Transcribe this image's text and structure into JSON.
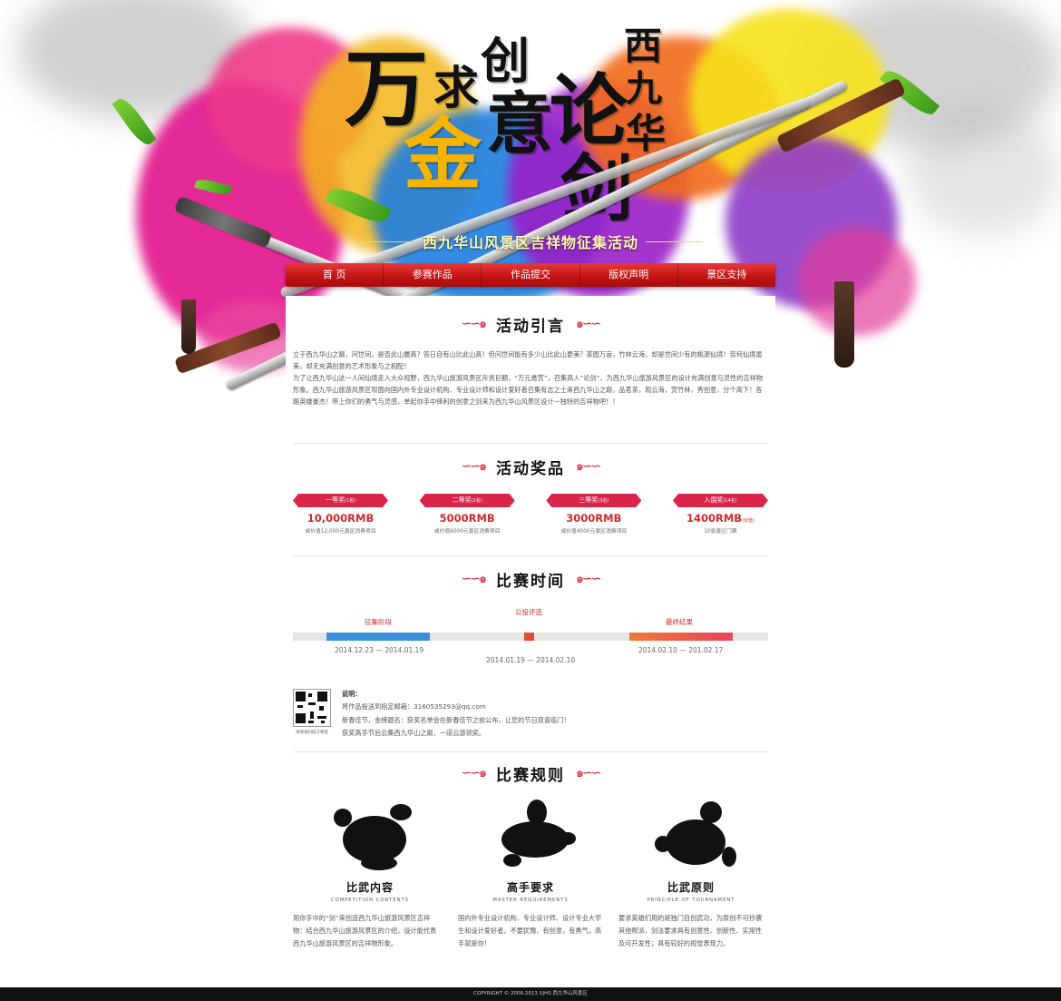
{
  "hero": {
    "title_chars": [
      "万",
      "求",
      "创",
      "金",
      "意",
      "论",
      "剑",
      "西",
      "九",
      "华"
    ],
    "subtitle": "西九华山风景区吉祥物征集活动"
  },
  "nav": {
    "items": [
      "首 页",
      "参赛作品",
      "作品提交",
      "版权声明",
      "景区支持"
    ]
  },
  "sections": {
    "intro_title": "活动引言",
    "prize_title": "活动奖品",
    "time_title": "比赛时间",
    "rules_title": "比赛规则"
  },
  "intro": {
    "p1": "立于西九华山之巅，问世间，是否此山最高？答日自有山比此山高！但问世间能有多少山比此山更美？茶园万亩，竹林云海，却是世间少有的桃源仙境！奈何仙境虽美，却无充满创意的艺术形象与之相配！",
    "p2": "为了让西九华山这一人间仙境走入大众视野，西九华山旅游风景区斥资巨额，“万元悬赏”，召集高人“论剑”，为西九华山旅游风景区的设计充满创意与灵性的吉祥物形象。西九华山旅游风景区现面向国内外专业设计机构、专业设计师和设计爱好者召集有志之士来西九华山之巅，品茗茶，观云海，赏竹林，秀创意，分个高下！各路英雄豪杰！带上你们的勇气与灵感，单起你手中锋利的创意之剑来为西九华山风景区设计一独特的吉祥物吧！！"
  },
  "prizes": [
    {
      "label": "一等奖",
      "count": "(1名)",
      "amount": "10,000RMB",
      "amount_note": "",
      "note": "或价值12,000元景区消费项目"
    },
    {
      "label": "二等奖",
      "count": "(2名)",
      "amount": "5000RMB",
      "amount_note": "",
      "note": "或价值6000元景区消费项目"
    },
    {
      "label": "三等奖",
      "count": "(3名)",
      "amount": "3000RMB",
      "amount_note": "",
      "note": "或价值4000元景区消费项目"
    },
    {
      "label": "入围奖",
      "count": "(14名)",
      "amount": "1400RMB",
      "amount_note": "(价值)",
      "note": "10张景区门票"
    }
  ],
  "timeline": {
    "stage1_label": "征集阶段",
    "stage1_date": "2014.12.23 — 2014.01.19",
    "stage2_label": "公投评选",
    "stage2_date": "2014.01.19 — 2014.02.10",
    "stage3_label": "最终结果",
    "stage3_date": "2014.02.10 — 201.02.17",
    "colors": {
      "stage1": "#3a8fd9",
      "stage2": "#e84a3a",
      "stage3": "#e8445a"
    }
  },
  "explain": {
    "qr_caption": "详情请扫描方物官",
    "head": "说明：",
    "lines": [
      "将作品投送到指定邮箱：3160535293@qq.com",
      "新春佳节，金榜题名：获奖名单会在新春佳节之前公布，让您的节日双喜临门！",
      "获奖高手节后云集西九华山之巅，一道云游领奖。"
    ]
  },
  "rules": [
    {
      "cn": "比武内容",
      "en": "COMPETITION CONTENTS",
      "text": "用你手中的“剑”来创造西九华山旅游风景区吉祥物：结合西九华山旅游风景区的介绍，设计能代表西九华山旅游风景区的吉祥物形象。"
    },
    {
      "cn": "高手要求",
      "en": "MASTER REQUIREMENTS",
      "text": "国内外专业设计机构、专业设计师、设计专业大学生和设计爱好者。不要犹豫，有创意，有勇气，高手就是你！"
    },
    {
      "cn": "比武原则",
      "en": "PRINCIPLE OF TOURNAMENT",
      "text": "要求英雄们用的是独门自创武功，为原创不可抄袭其他帮派，剑法要求具有创意性、创新性、实用性及可开发性；具有较好的视觉表现力。"
    }
  ],
  "footer": {
    "text": "COPYRIGHT © 2006-2013 XJHS 西九华山风景区"
  }
}
